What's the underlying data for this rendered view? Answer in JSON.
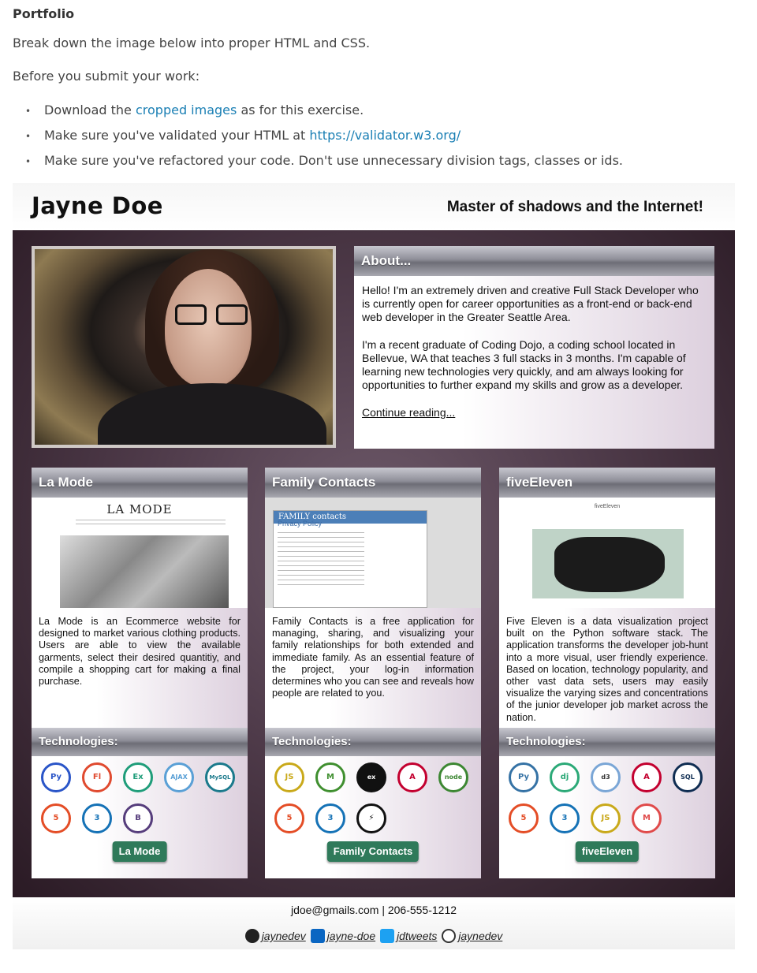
{
  "instructions": {
    "heading": "Portfolio",
    "intro": "Break down the image below into proper HTML and CSS.",
    "before": "Before you submit your work:",
    "bullets": {
      "b1_pre": "Download the ",
      "b1_link": "cropped images",
      "b1_post": " as for this exercise.",
      "b2_pre": "Make sure you've validated your HTML at ",
      "b2_link": "https://validator.w3.org/",
      "b3": "Make sure you've refactored your code. Don't use unnecessary division tags, classes or ids."
    }
  },
  "mock": {
    "name": "Jayne Doe",
    "tagline": "Master of shadows and the Internet!",
    "about": {
      "title": "About...",
      "p1": "Hello! I'm an extremely driven and creative Full Stack Developer who is currently open for career opportunities as a front-end or back-end web developer in the Greater Seattle Area.",
      "p2": "I'm a recent graduate of Coding Dojo, a coding school located in Bellevue, WA that teaches 3 full stacks in 3 months. I'm capable of learning new technologies very quickly, and am always looking for opportunities to further expand my skills and grow as a developer.",
      "more": "Continue reading..."
    },
    "cards": [
      {
        "title": "La Mode",
        "shot_title": "LA MODE",
        "desc": "La Mode is an Ecommerce website for designed to market various clothing products. Users are able to view the available garments, select their desired quantitiy, and compile a shopping cart for making a final purchase.",
        "tech_title": "Technologies:",
        "icons": [
          "Py",
          "Fl",
          "Ex",
          "AJAX",
          "MySQL",
          "5",
          "3",
          "B"
        ],
        "button": "La Mode"
      },
      {
        "title": "Family Contacts",
        "shot_bar": "FAMILY contacts",
        "shot_heading": "Privacy Policy",
        "desc": "Family Contacts is a free application for managing, sharing, and visualizing your family relationships for both extended and immediate family. As an essential feature of the project, your log-in information determines who you can see and reveals how people are related to you.",
        "tech_title": "Technologies:",
        "icons": [
          "JS",
          "M",
          "ex",
          "A",
          "node",
          "5",
          "3",
          "⚡"
        ],
        "button": "Family Contacts"
      },
      {
        "title": "fiveEleven",
        "shot_title": "fiveEleven",
        "desc": "Five Eleven is a data visualization project built on the Python software stack. The application transforms the developer job-hunt into a more visual, user friendly experience. Based on location, technology popularity, and other vast data sets, users may easily visualize the varying sizes and concentrations of the junior developer job market across the nation.",
        "tech_title": "Technologies:",
        "icons": [
          "Py",
          "dj",
          "d3",
          "A",
          "SQL",
          "5",
          "3",
          "JS",
          "M"
        ],
        "button": "fiveEleven"
      }
    ],
    "footer": {
      "contact": "jdoe@gmails.com | 206-555-1212",
      "github": "jaynedev",
      "linkedin": "jayne-doe",
      "twitter": "jdtweets",
      "dribbble": "jaynedev"
    }
  },
  "colors": {
    "link": "#1a7fb4",
    "button": "#2f7a5a"
  }
}
